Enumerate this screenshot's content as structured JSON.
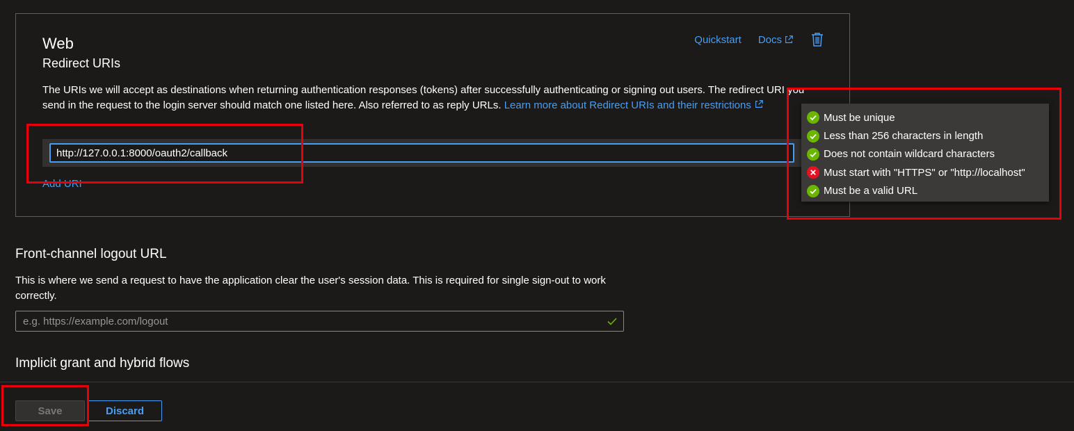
{
  "web_card": {
    "title": "Web",
    "subtitle": "Redirect URIs",
    "quickstart_label": "Quickstart",
    "docs_label": "Docs",
    "description_text": "The URIs we will accept as destinations when returning authentication responses (tokens) after successfully authenticating or signing out users. The redirect URI you send in the request to the login server should match one listed here. Also referred to as reply URLs. ",
    "learn_more_label": "Learn more about Redirect URIs and their restrictions",
    "redirect_uri_value": "http://127.0.0.1:8000/oauth2/callback",
    "add_uri_label": "Add URI"
  },
  "validation": {
    "rules": [
      {
        "text": "Must be unique",
        "status": "pass"
      },
      {
        "text": "Less than 256 characters in length",
        "status": "pass"
      },
      {
        "text": "Does not contain wildcard characters",
        "status": "pass"
      },
      {
        "text": "Must start with \"HTTPS\" or \"http://localhost\"",
        "status": "fail"
      },
      {
        "text": "Must be a valid URL",
        "status": "pass"
      }
    ]
  },
  "front_channel": {
    "title": "Front-channel logout URL",
    "description": "This is where we send a request to have the application clear the user's session data. This is required for single sign-out to work correctly.",
    "placeholder": "e.g. https://example.com/logout"
  },
  "implicit_grant": {
    "title": "Implicit grant and hybrid flows"
  },
  "footer": {
    "save_label": "Save",
    "discard_label": "Discard"
  },
  "colors": {
    "accent": "#479ef5",
    "pass": "#6bb700",
    "fail": "#e81123",
    "annotation": "#e8000b"
  }
}
